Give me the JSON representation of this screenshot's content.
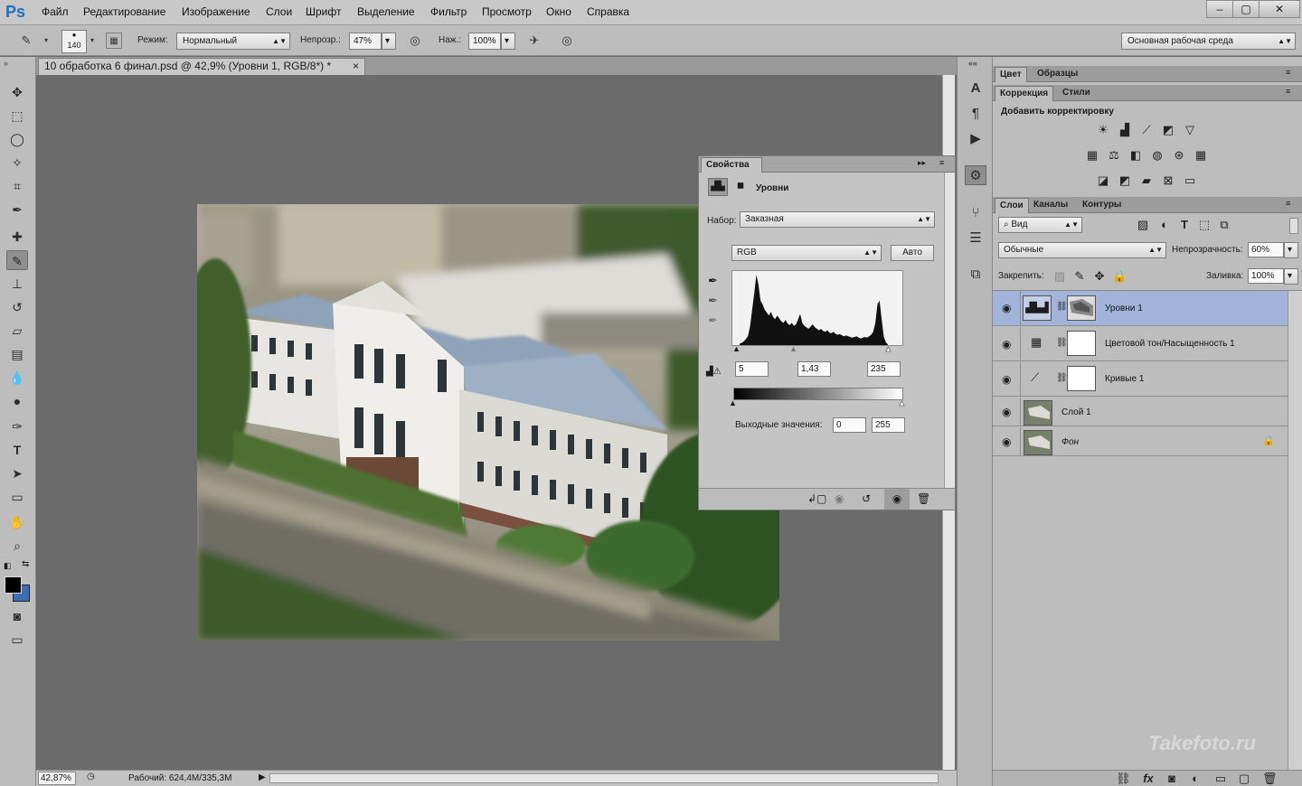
{
  "app": {
    "logo": "Ps"
  },
  "menu": [
    "Файл",
    "Редактирование",
    "Изображение",
    "Слои",
    "Шрифт",
    "Выделение",
    "Фильтр",
    "Просмотр",
    "Окно",
    "Справка"
  ],
  "window_controls": [
    "–",
    "▢",
    "✕"
  ],
  "options": {
    "brush_size": "140",
    "mode_label": "Режим:",
    "mode_value": "Нормальный",
    "opacity_label": "Непрозр.:",
    "opacity_value": "47%",
    "pressure_label": "Наж.:",
    "pressure_value": "100%",
    "workspace": "Основная рабочая среда"
  },
  "document": {
    "tab_title": "10 обработка 6 финал.psd @ 42,9% (Уровни 1, RGB/8*) *",
    "close": "×"
  },
  "status": {
    "zoom": "42,87%",
    "info": "Рабочий: 624,4M/335,3M"
  },
  "properties": {
    "tab": "Свойства",
    "title": "Уровни",
    "preset_label": "Набор:",
    "preset_value": "Заказная",
    "channel": "RGB",
    "auto_button": "Авто",
    "input_black": "5",
    "input_mid": "1,43",
    "input_white": "235",
    "output_label": "Выходные значения:",
    "output_black": "0",
    "output_white": "255",
    "histogram": [
      2,
      3,
      5,
      8,
      12,
      25,
      48,
      70,
      95,
      82,
      60,
      55,
      48,
      44,
      40,
      45,
      38,
      35,
      40,
      36,
      32,
      30,
      34,
      29,
      27,
      30,
      26,
      28,
      35,
      42,
      30,
      26,
      24,
      22,
      25,
      28,
      24,
      22,
      20,
      22,
      19,
      18,
      20,
      17,
      16,
      18,
      15,
      14,
      15,
      13,
      12,
      13,
      12,
      11,
      10,
      11,
      12,
      10,
      9,
      10,
      11,
      10,
      12,
      14,
      18,
      30,
      55,
      60,
      35,
      12,
      4,
      1
    ]
  },
  "right_panels": {
    "tabs_top": [
      "Цвет",
      "Образцы"
    ],
    "tabs_adj": [
      "Коррекция",
      "Стили"
    ],
    "add_adjustment": "Добавить корректировку",
    "tabs_layers": [
      "Слои",
      "Каналы",
      "Контуры"
    ],
    "filter_kind": "Вид",
    "blend_mode": "Обычные",
    "opacity_label": "Непрозрачность:",
    "opacity_value": "60%",
    "lock_label": "Закрепить:",
    "fill_label": "Заливка:",
    "fill_value": "100%"
  },
  "layers": [
    {
      "name": "Уровни 1",
      "selected": true
    },
    {
      "name": "Цветовой тон/Насыщенность 1",
      "selected": false
    },
    {
      "name": "Кривые 1",
      "selected": false
    },
    {
      "name": "Слой 1",
      "selected": false
    },
    {
      "name": "Фон",
      "selected": false
    }
  ],
  "watermark": "Takefoto.ru"
}
